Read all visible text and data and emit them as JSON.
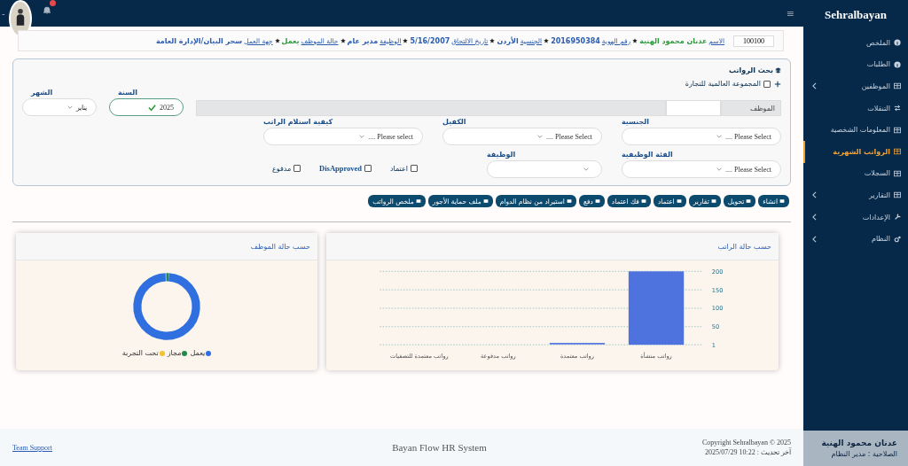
{
  "brand": "Sehralbayan",
  "sidebar": {
    "items": [
      {
        "label": "الملخص",
        "selected": false,
        "expandable": false
      },
      {
        "label": "الطلبات",
        "selected": false,
        "expandable": false
      },
      {
        "label": "الموظفين",
        "selected": false,
        "expandable": true
      },
      {
        "label": "التنقلات",
        "selected": false,
        "expandable": false
      },
      {
        "label": "المعلومات الشخصية",
        "selected": false,
        "expandable": false
      },
      {
        "label": "الرواتب الشهرية",
        "selected": true,
        "expandable": false
      },
      {
        "label": "السجلات",
        "selected": false,
        "expandable": false
      },
      {
        "label": "التقارير",
        "selected": false,
        "expandable": true
      },
      {
        "label": "الإعدادات",
        "selected": false,
        "expandable": true
      },
      {
        "label": "النظام",
        "selected": false,
        "expandable": true
      }
    ],
    "user": {
      "name": "عدنان محمود الهنية",
      "role": "الصلاحية : مدير النظام"
    }
  },
  "topbar": {
    "menu_glyph": "≡",
    "dash": "-"
  },
  "employee_bar": {
    "code": "100100",
    "fields": [
      {
        "label": "الاسم",
        "value": "عدنان محمود الهنية",
        "color": "#2e9a3e"
      },
      {
        "label": "رقم الهوية",
        "value": "2016950384",
        "color": "#2a5db0"
      },
      {
        "label": "الجنسية",
        "value": "الأردن",
        "color": "#2a5db0"
      },
      {
        "label": "تاريخ الالتحاق",
        "value": "5/16/2007",
        "color": "#2a5db0"
      },
      {
        "label": "الوظيفة",
        "value": "مدير عام",
        "color": "#2a5db0"
      },
      {
        "label": "حالة الموظف",
        "value": "يعمل",
        "color": "#2e9a3e"
      },
      {
        "label": "جهة العمل",
        "value": "سحر البيان/الإدارة العامة",
        "color": "#2a5db0"
      }
    ]
  },
  "search": {
    "title": "بحث الرواتب",
    "company": {
      "label": "المجموعة العالمية للتجارة",
      "checked": false
    },
    "employee_label": "الموظف",
    "year": {
      "label": "السنة",
      "value": "2025"
    },
    "month": {
      "label": "الشهر",
      "value": "يناير"
    },
    "selects": [
      {
        "label": "الجنسية",
        "value": "Please Select ...."
      },
      {
        "label": "الكفيل",
        "value": "Please Select ...."
      },
      {
        "label": "كيفية استلام الراتب",
        "value": "Please select ...."
      },
      {
        "label": "الفئة الوظيفية",
        "value": "Please Select ...."
      },
      {
        "label": "الوظيفة"
      }
    ],
    "checks": [
      {
        "label": "اعتماد",
        "checked": false
      },
      {
        "label": "DisApproved",
        "checked": false
      },
      {
        "label": "مدفوع",
        "checked": false
      }
    ]
  },
  "toolbar": [
    {
      "label": "انشاء"
    },
    {
      "label": "تحويل"
    },
    {
      "label": "تقارير"
    },
    {
      "label": "اعتماد"
    },
    {
      "label": "فك اعتماد"
    },
    {
      "label": "دفع"
    },
    {
      "label": "استيراد من نظام الدوام"
    },
    {
      "label": "ملف حماية الأجور"
    },
    {
      "label": "ملخص الرواتب"
    }
  ],
  "salary_chart": {
    "title": "حسب حالة الراتب",
    "chart_data": {
      "type": "bar",
      "categories": [
        "رواتب معتمدة للتصفيات",
        "رواتب مدفوعة",
        "رواتب معتمدة",
        "رواتب منشأة"
      ],
      "values": [
        null,
        null,
        3,
        200
      ],
      "ylim": [
        1,
        200
      ],
      "yticks": [
        1,
        50,
        100,
        150,
        200
      ],
      "grid": true
    }
  },
  "employee_chart": {
    "title": "حسب حالة الموظف",
    "legend": [
      {
        "label": "يعمل",
        "color": "#2f6fe0"
      },
      {
        "label": "مجاز",
        "color": "#1f8a4c"
      },
      {
        "label": "تحت التجربة",
        "color": "#f2c230"
      }
    ]
  },
  "footer": {
    "support": "Team Support",
    "system": "Bayan Flow HR System",
    "copyright": "Copyright Sehralbayan © 2025",
    "updated": "آخر تحديث : 10:22 2025/07/29"
  }
}
